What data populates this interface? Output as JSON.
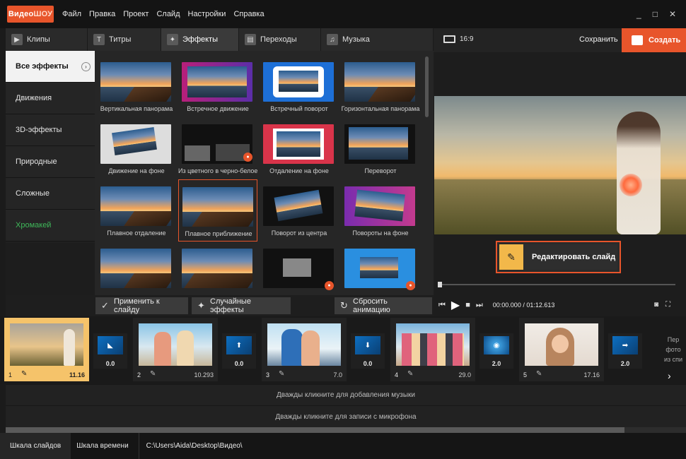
{
  "app": {
    "logo_main": "Видео",
    "logo_alt": "ШОУ"
  },
  "menu": [
    "Файл",
    "Правка",
    "Проект",
    "Слайд",
    "Настройки",
    "Справка"
  ],
  "window_controls": [
    "_",
    "□",
    "✕"
  ],
  "tabs": [
    {
      "label": "Клипы",
      "icon": "film-icon"
    },
    {
      "label": "Титры",
      "icon": "text-icon"
    },
    {
      "label": "Эффекты",
      "icon": "magic-wand-icon"
    },
    {
      "label": "Переходы",
      "icon": "transition-icon"
    },
    {
      "label": "Музыка",
      "icon": "music-icon"
    }
  ],
  "categories": [
    "Все эффекты",
    "Движения",
    "3D-эффекты",
    "Природные",
    "Сложные",
    "Хромакей"
  ],
  "effects": [
    "Вертикальная панорама",
    "Встречное движение",
    "Встречный поворот",
    "Горизонтальная панорама",
    "Движение на фоне",
    "Из цветного в черно-белое",
    "Отдаление на фоне",
    "Переворот",
    "Плавное отдаление",
    "Плавное приближение",
    "Поворот из центра",
    "Повороты на фоне"
  ],
  "actions": {
    "apply": "Применить к слайду",
    "random": "Случайные эффекты",
    "reset": "Сбросить анимацию"
  },
  "preview": {
    "ratio": "16:9",
    "save": "Сохранить",
    "create": "Создать",
    "edit_slide": "Редактировать слайд",
    "time_current": "00:00.000",
    "time_sep": " / ",
    "time_total": "01:12.613"
  },
  "slides": [
    {
      "num": "1",
      "duration": "11.16"
    },
    {
      "num": "2",
      "duration": "10.293"
    },
    {
      "num": "3",
      "duration": "7.0"
    },
    {
      "num": "4",
      "duration": "29.0"
    },
    {
      "num": "5",
      "duration": "17.16"
    }
  ],
  "transitions": [
    "0.0",
    "0.0",
    "0.0",
    "2.0",
    "2.0"
  ],
  "more_slides_text": [
    "Пер",
    "фото",
    "из спи"
  ],
  "tracks": {
    "music": "Дважды кликните для добавления музыки",
    "mic": "Дважды кликните для записи с микрофона"
  },
  "status": {
    "tab_slides": "Шкала слайдов",
    "tab_timeline": "Шкала времени",
    "path": "C:\\Users\\Aida\\Desktop\\Видео\\"
  },
  "colors": {
    "accent": "#e8552b",
    "chromakey": "#3fb95a",
    "edit_icon_bg": "#f2b84a"
  }
}
